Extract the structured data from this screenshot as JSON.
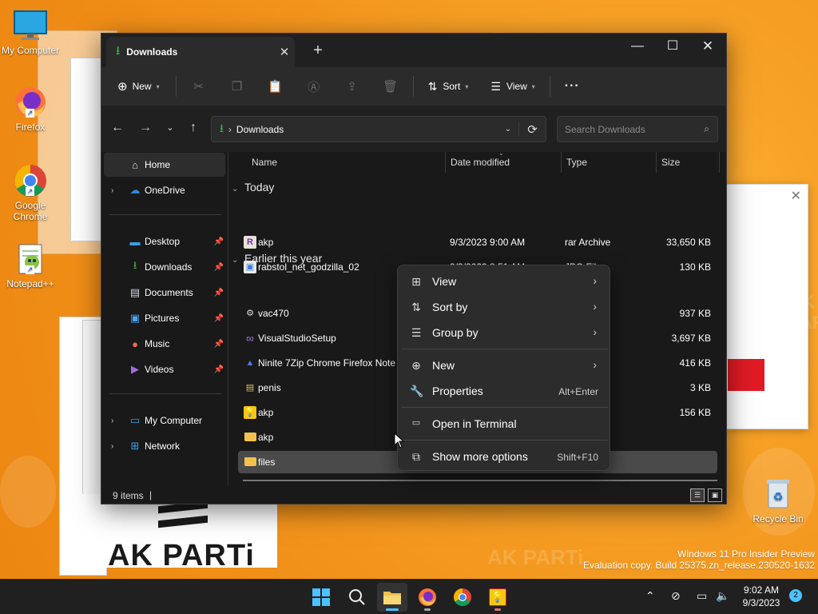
{
  "desktop": {
    "icons": [
      {
        "label": "My Computer"
      },
      {
        "label": "Firefox"
      },
      {
        "label": "Google Chrome"
      },
      {
        "label": "Notepad++"
      },
      {
        "label": "Recycle Bin"
      }
    ],
    "watermark": {
      "line1": "Windows 11 Pro Insider Preview",
      "line2": "Evaluation copy. Build 25375.zn_release.230520-1632"
    },
    "background_text": "AK PARTi",
    "panel_text": "AK PARTi",
    "brand_color": "#f39a1e"
  },
  "explorer": {
    "tab_title": "Downloads",
    "command_bar": {
      "new_label": "New",
      "sort_label": "Sort",
      "view_label": "View",
      "more_label": "···"
    },
    "address": {
      "crumb": "Downloads",
      "search_placeholder": "Search Downloads"
    },
    "sidebar": {
      "items": [
        {
          "label": "Home"
        },
        {
          "label": "OneDrive"
        },
        {
          "label": "Desktop"
        },
        {
          "label": "Downloads"
        },
        {
          "label": "Documents"
        },
        {
          "label": "Pictures"
        },
        {
          "label": "Music"
        },
        {
          "label": "Videos"
        },
        {
          "label": "My Computer"
        },
        {
          "label": "Network"
        }
      ]
    },
    "columns": {
      "name": "Name",
      "date": "Date modified",
      "type": "Type",
      "size": "Size"
    },
    "groups": {
      "today": "Today",
      "earlier": "Earlier this year"
    },
    "files": [
      {
        "name": "akp",
        "date": "9/3/2023 9:00 AM",
        "type": "rar Archive",
        "size": "33,650 KB"
      },
      {
        "name": "rabstol_net_godzilla_02",
        "date": "9/3/2023 8:51 AM",
        "type": "JPG File",
        "size": "130 KB"
      },
      {
        "name": "vac470",
        "date": "",
        "type": "n",
        "size": "937 KB"
      },
      {
        "name": "VisualStudioSetup",
        "date": "",
        "type": "n",
        "size": "3,697 KB"
      },
      {
        "name": "Ninite 7Zip Chrome Firefox Note",
        "date": "",
        "type": "n",
        "size": "416 KB"
      },
      {
        "name": "penis",
        "date": "",
        "type": "ertificate",
        "size": "3 KB"
      },
      {
        "name": "akp",
        "date": "",
        "type": "n",
        "size": "156 KB"
      },
      {
        "name": "akp",
        "date": "",
        "type": "",
        "size": ""
      },
      {
        "name": "files",
        "date": "",
        "type": "",
        "size": ""
      }
    ],
    "status": {
      "count": "9 items"
    }
  },
  "context_menu": {
    "items": [
      {
        "label": "View",
        "shortcut": ""
      },
      {
        "label": "Sort by",
        "shortcut": ""
      },
      {
        "label": "Group by",
        "shortcut": ""
      },
      {
        "label": "New",
        "shortcut": ""
      },
      {
        "label": "Properties",
        "shortcut": "Alt+Enter"
      },
      {
        "label": "Open in Terminal",
        "shortcut": ""
      },
      {
        "label": "Show more options",
        "shortcut": "Shift+F10"
      }
    ]
  },
  "taskbar": {
    "clock": {
      "time": "9:02 AM",
      "date": "9/3/2023"
    },
    "notification_count": "2"
  }
}
